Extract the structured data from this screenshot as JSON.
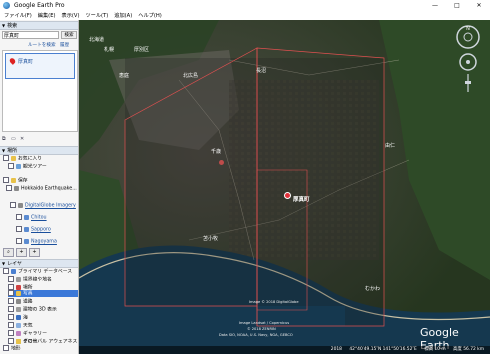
{
  "window": {
    "title": "Google Earth Pro",
    "controls": [
      "—",
      "□",
      "✕"
    ]
  },
  "menu": [
    "ファイル(F)",
    "編集(E)",
    "表示(V)",
    "ツール(T)",
    "追加(A)",
    "ヘルプ(H)"
  ],
  "search": {
    "header": "検索",
    "query": "厚真町",
    "button": "検索",
    "links": [
      "ルートを検索",
      "履歴"
    ],
    "result": "厚真町"
  },
  "places": {
    "header": "場所",
    "items": [
      {
        "label": "お気に入り",
        "indent": 0
      },
      {
        "label": "観光ツアー",
        "indent": 1
      },
      {
        "label": "保存",
        "indent": 0
      },
      {
        "label": "Hokkaido Earthquake...",
        "indent": 1
      },
      {
        "label": "DigitalGlobe Imagery",
        "indent": 2,
        "link": true
      },
      {
        "label": "Chitou",
        "indent": 3,
        "link": true
      },
      {
        "label": "Sapporo",
        "indent": 3,
        "link": true
      },
      {
        "label": "Nagoyama",
        "indent": 3,
        "link": true
      }
    ]
  },
  "layers": {
    "header": "レイヤ",
    "items": [
      {
        "label": "プライマリ データベース",
        "indent": 0
      },
      {
        "label": "境界線や地名",
        "indent": 1
      },
      {
        "label": "場所",
        "indent": 1
      },
      {
        "label": "写真",
        "indent": 1,
        "selected": true
      },
      {
        "label": "道路",
        "indent": 1
      },
      {
        "label": "建物の 3D 表示",
        "indent": 1
      },
      {
        "label": "海",
        "indent": 1
      },
      {
        "label": "天気",
        "indent": 1
      },
      {
        "label": "ギャラリー",
        "indent": 1
      },
      {
        "label": "グローバル アウェアネス",
        "indent": 1
      },
      {
        "label": "その他",
        "indent": 1
      }
    ],
    "footer": "地形"
  },
  "map": {
    "labels": [
      {
        "text": "北海道",
        "kind": "city"
      },
      {
        "text": "札幌",
        "kind": "city"
      },
      {
        "text": "厚別区",
        "kind": "city"
      },
      {
        "text": "北広島",
        "kind": "city"
      },
      {
        "text": "恵庭",
        "kind": "city"
      },
      {
        "text": "長沼",
        "kind": "city"
      },
      {
        "text": "千歳",
        "kind": "city"
      },
      {
        "text": "由仁",
        "kind": "city"
      },
      {
        "text": "苫小牧",
        "kind": "city"
      },
      {
        "text": "厚真町",
        "kind": "target"
      },
      {
        "text": "むかわ",
        "kind": "city"
      },
      {
        "text": "平取",
        "kind": "city"
      },
      {
        "text": "夕張",
        "kind": "city"
      }
    ],
    "credits": [
      "Image © 2018 DigitalGlobe",
      "Image Landsat / Copernicus",
      "© 2018 ZENRIN",
      "Data SIO, NOAA, U.S. Navy, NGA, GEBCO"
    ],
    "logo": "Google Earth",
    "status": {
      "date": "2018",
      "coords": "42°40′49.15″N 141°50′16.52″E",
      "elev": "標高 10 m",
      "eye": "高度 56.72 km"
    }
  },
  "colors": {
    "accent": "#3b78d8",
    "polygon": "#e05050",
    "map_bg": "#2e3b2a"
  }
}
